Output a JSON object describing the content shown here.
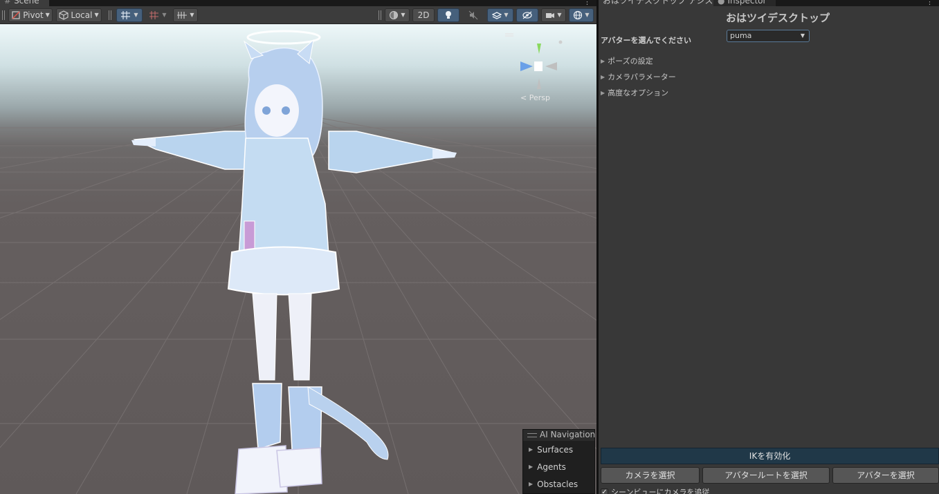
{
  "scene": {
    "tab_label": "Scene",
    "toolbar": {
      "pivot_label": "Pivot",
      "local_label": "Local",
      "mode_2d_label": "2D"
    },
    "camera_label": "< Persp"
  },
  "ai_navigation": {
    "title": "AI Navigation",
    "items": [
      {
        "label": "Surfaces"
      },
      {
        "label": "Agents"
      },
      {
        "label": "Obstacles"
      }
    ]
  },
  "tool": {
    "tabs": [
      {
        "label": "おはツイデスクトップ アシスタント"
      },
      {
        "label": "Inspector"
      }
    ],
    "title": "おはツイデスクトップ",
    "avatar_prompt": "アバターを選んでください",
    "avatar_dropdown_value": "puma",
    "foldouts": [
      {
        "label": "ポーズの設定"
      },
      {
        "label": "カメラパラメーター"
      },
      {
        "label": "高度なオプション"
      }
    ],
    "enable_ik_label": "IKを有効化",
    "select_camera_label": "カメラを選択",
    "select_avatar_root_label": "アバタールートを選択",
    "select_avatar_label": "アバターを選択",
    "follow_camera_label": "シーンビューにカメラを追従",
    "follow_camera_checked": true
  }
}
